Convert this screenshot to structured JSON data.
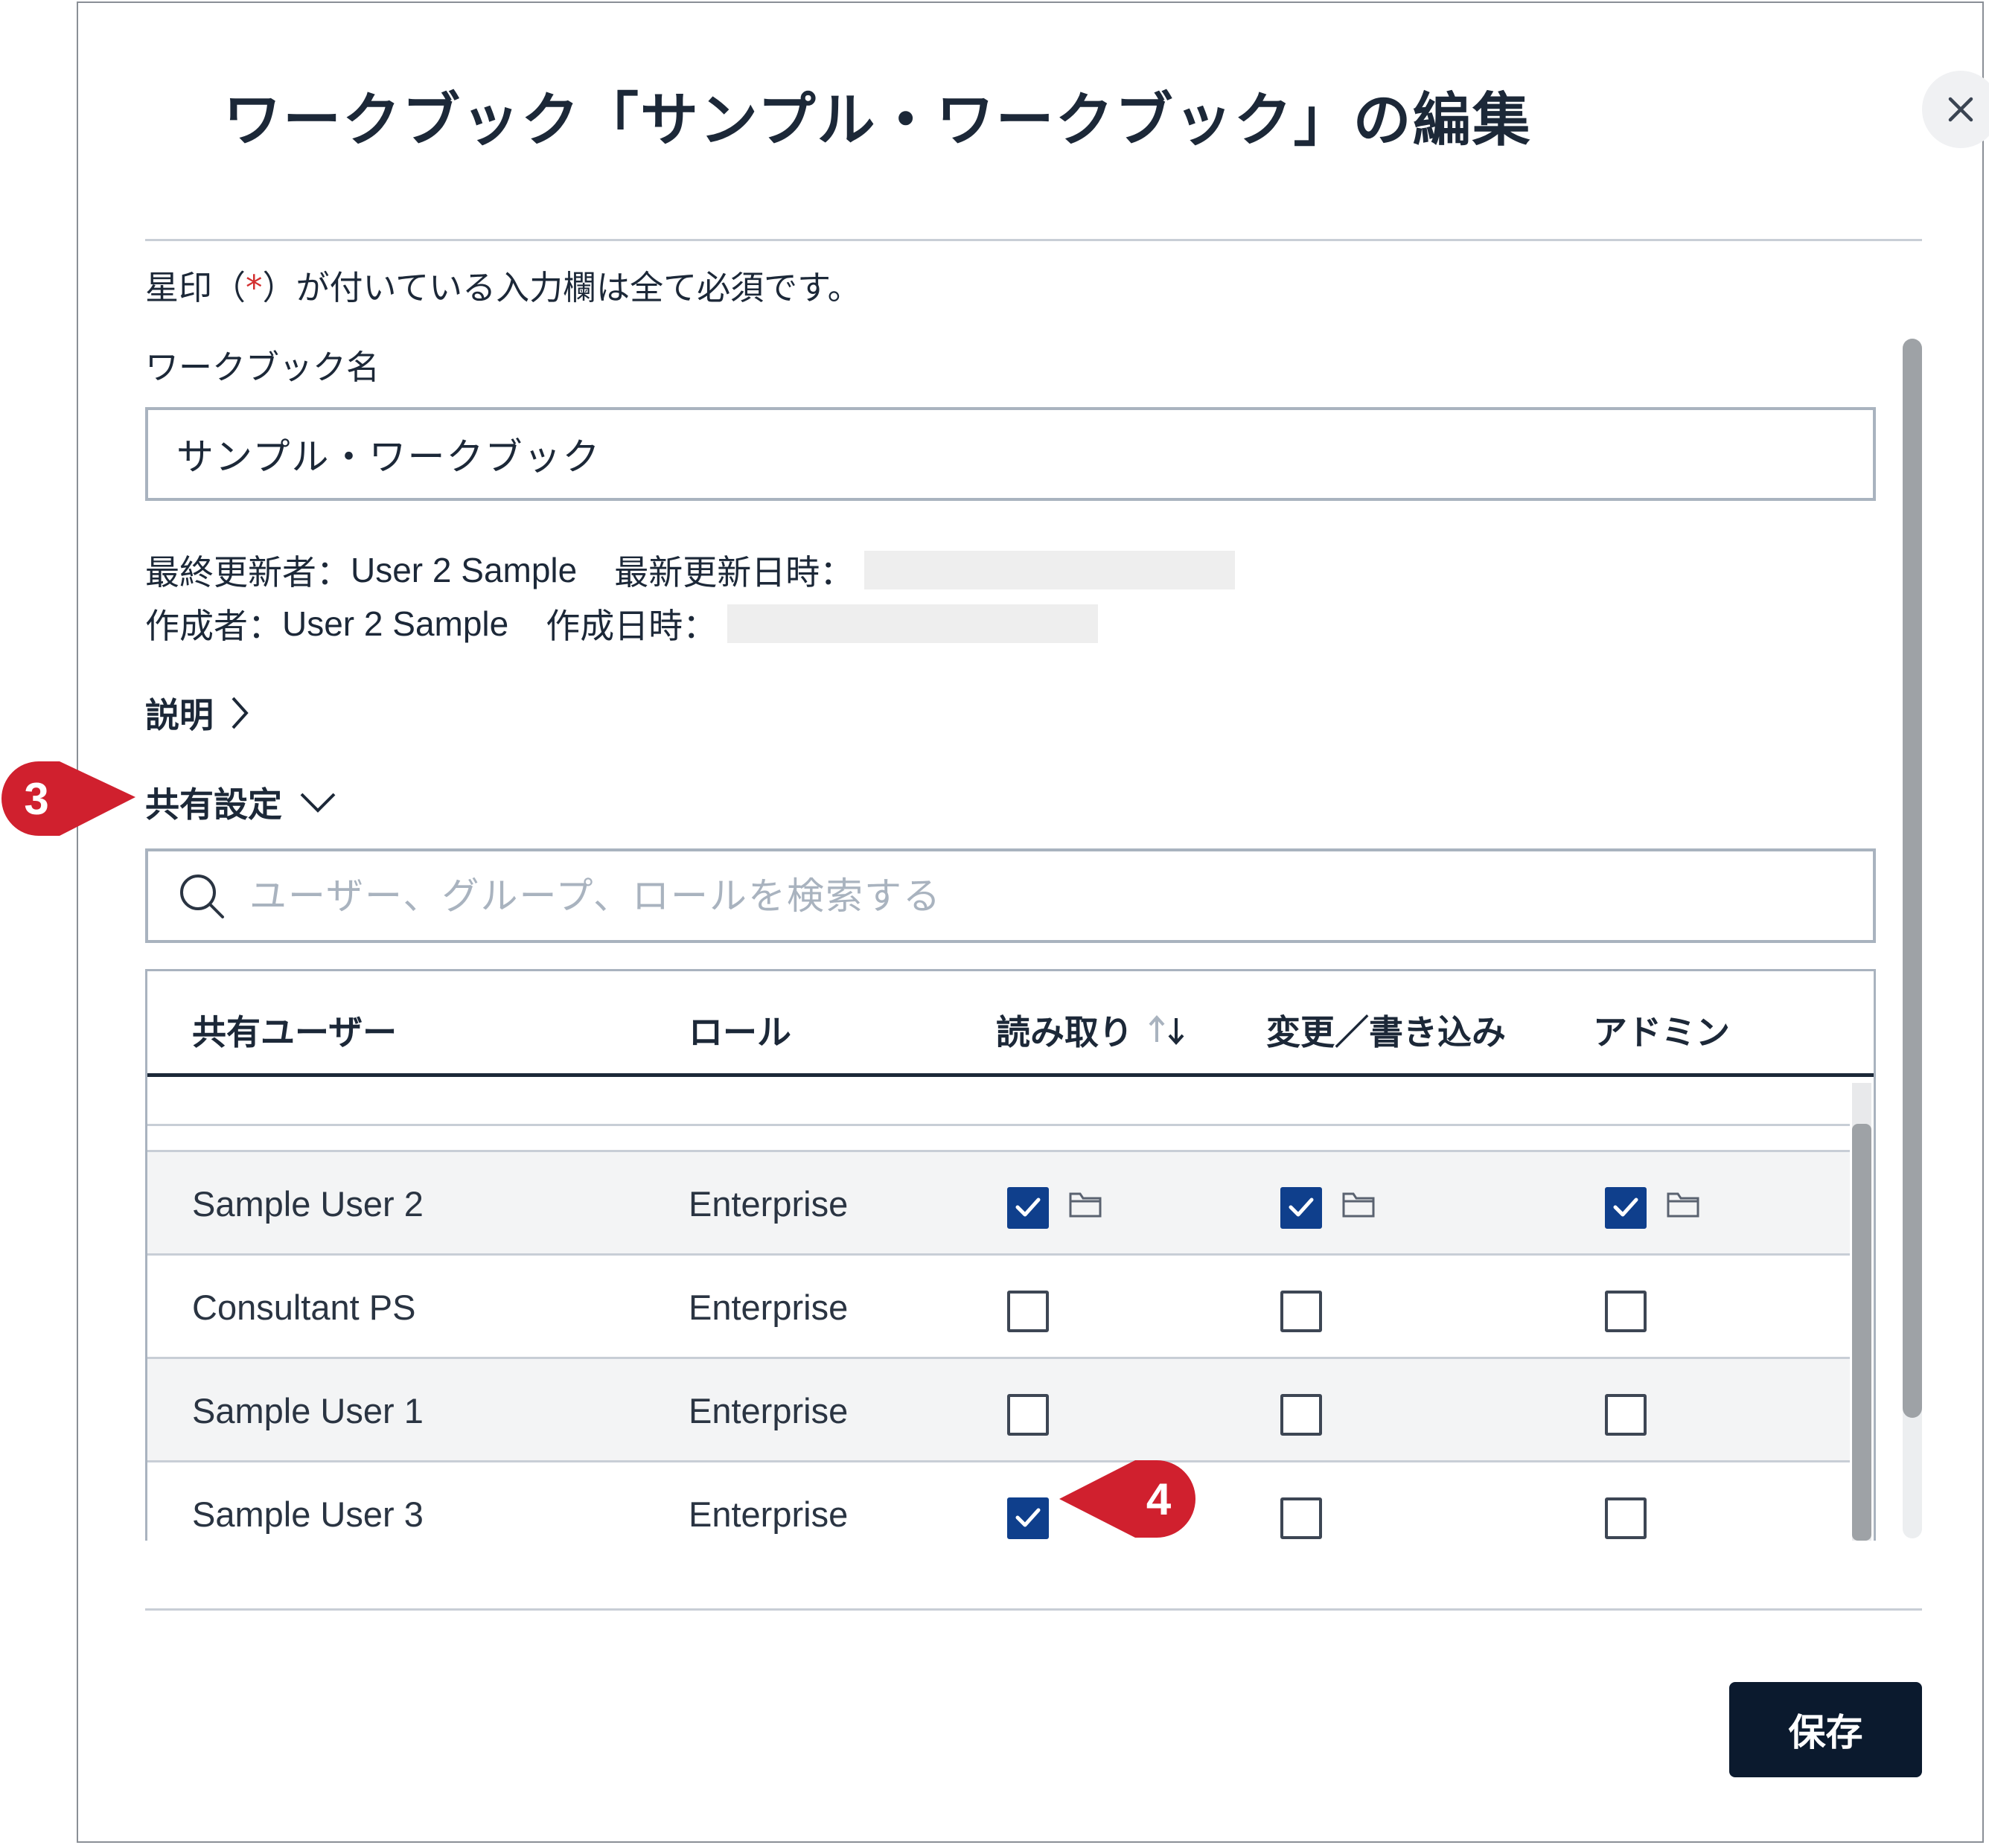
{
  "dialog": {
    "title": "ワークブック「サンプル・ワークブック」の編集",
    "close_icon": "close-icon"
  },
  "required_note": "星印（*）が付いている入力欄は全て必須です。",
  "required_asterisk_color": "#d32f2f",
  "workbook_name": {
    "label": "ワークブック名",
    "value": "サンプル・ワークブック"
  },
  "meta": {
    "last_updated_by_label": "最終更新者：",
    "last_updated_by": "User 2 Sample",
    "last_updated_at_label": "最新更新日時：",
    "created_by_label": "作成者：",
    "created_by": "User 2 Sample",
    "created_at_label": "作成日時："
  },
  "description": {
    "label": "説明",
    "icon": "chevron-right-icon"
  },
  "sharing": {
    "label": "共有設定",
    "icon": "chevron-down-icon",
    "search_placeholder": "ユーザー、グループ、ロールを検索する",
    "columns": {
      "user": "共有ユーザー",
      "role": "ロール",
      "read": "読み取り",
      "write": "変更／書き込み",
      "admin": "アドミン"
    },
    "rows": [
      {
        "user": "Sample User 2",
        "role": "Enterprise",
        "read": true,
        "write": true,
        "admin": true,
        "folder_icons": true
      },
      {
        "user": "Consultant PS",
        "role": "Enterprise",
        "read": false,
        "write": false,
        "admin": false,
        "folder_icons": false
      },
      {
        "user": "Sample User 1",
        "role": "Enterprise",
        "read": false,
        "write": false,
        "admin": false,
        "folder_icons": false
      },
      {
        "user": "Sample User 3",
        "role": "Enterprise",
        "read": true,
        "write": false,
        "admin": false,
        "folder_icons": false
      }
    ]
  },
  "save_button": "保存",
  "callouts": [
    {
      "number": "3",
      "target": "sharing-settings"
    },
    {
      "number": "4",
      "target": "sample-user-3-read"
    }
  ],
  "colors": {
    "primary": "#0b1a2e",
    "checkbox": "#0f3f8c",
    "callout": "#d0202e"
  }
}
